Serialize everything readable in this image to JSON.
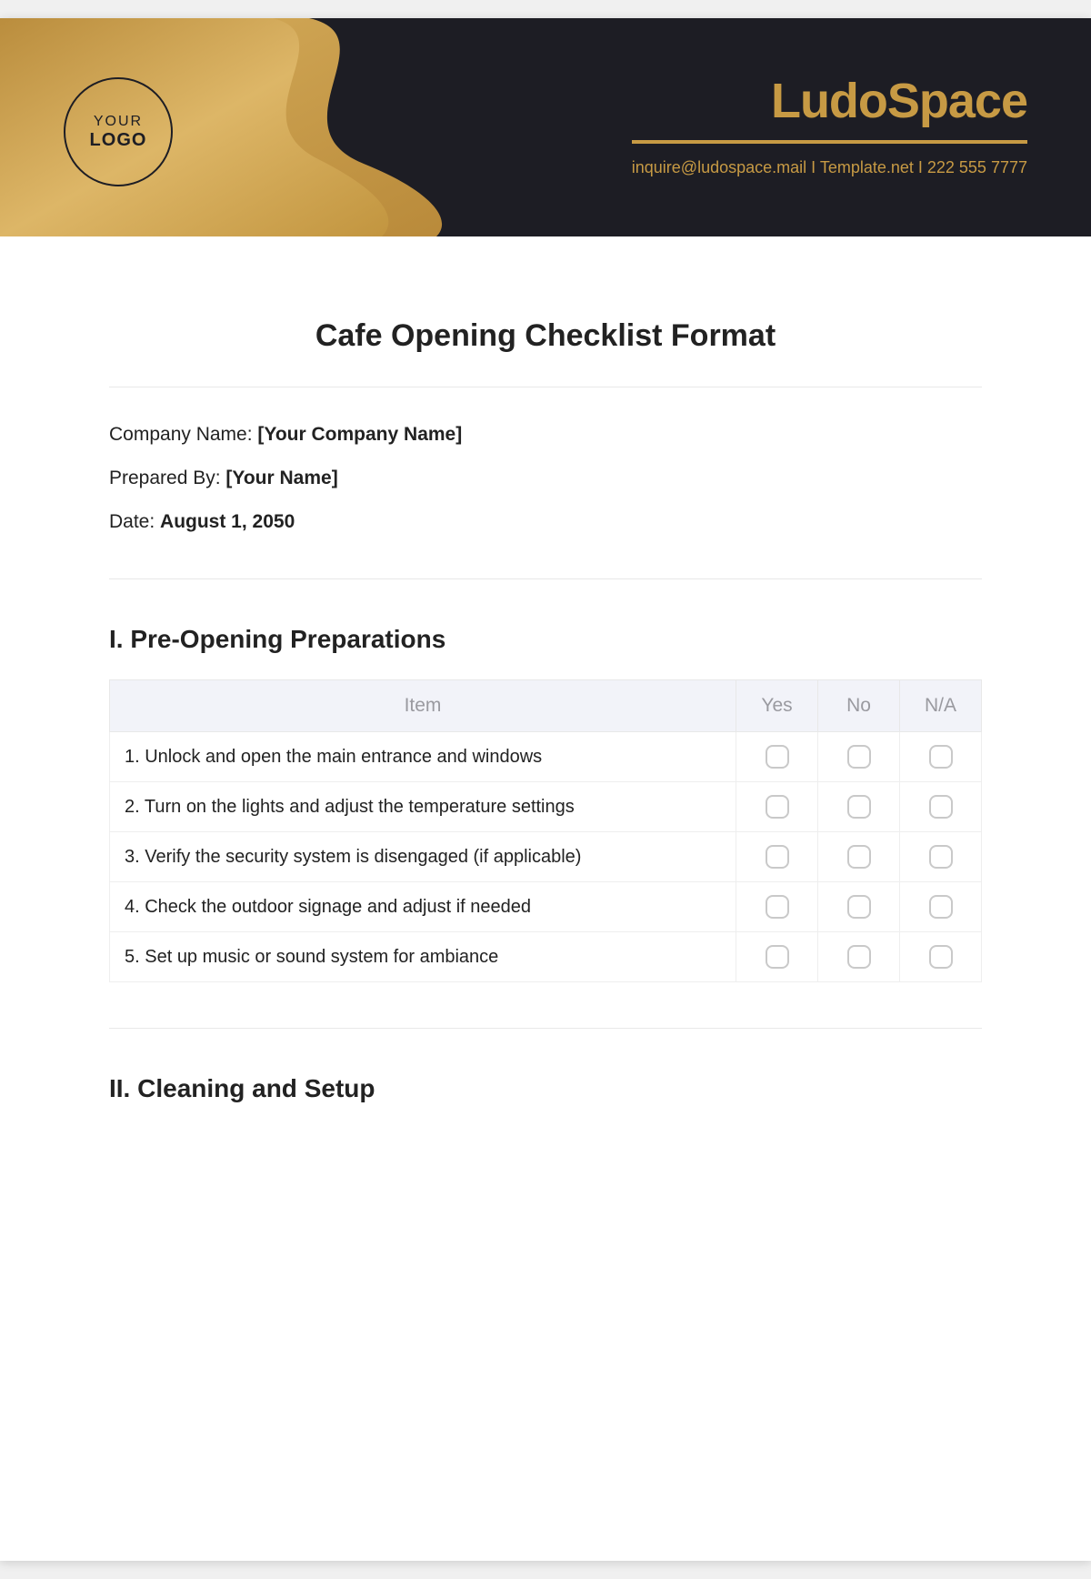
{
  "header": {
    "logo": {
      "line1": "YOUR",
      "line2": "LOGO"
    },
    "brand": "LudoSpace",
    "contact": "inquire@ludospace.mail I Template.net I 222 555 7777"
  },
  "document": {
    "title": "Cafe Opening Checklist Format",
    "meta": [
      {
        "label": "Company Name: ",
        "value": "[Your Company Name]"
      },
      {
        "label": "Prepared By: ",
        "value": "[Your Name]"
      },
      {
        "label": "Date: ",
        "value": "August 1, 2050"
      }
    ],
    "sections": [
      {
        "heading": "I. Pre-Opening Preparations",
        "columns": {
          "item": "Item",
          "yes": "Yes",
          "no": "No",
          "na": "N/A"
        },
        "rows": [
          "1. Unlock and open the main entrance and windows",
          "2. Turn on the lights and adjust the temperature settings",
          "3. Verify the security system is disengaged (if applicable)",
          "4. Check the outdoor signage and adjust if needed",
          "5. Set up music or sound system for ambiance"
        ]
      },
      {
        "heading": "II. Cleaning and Setup"
      }
    ]
  }
}
